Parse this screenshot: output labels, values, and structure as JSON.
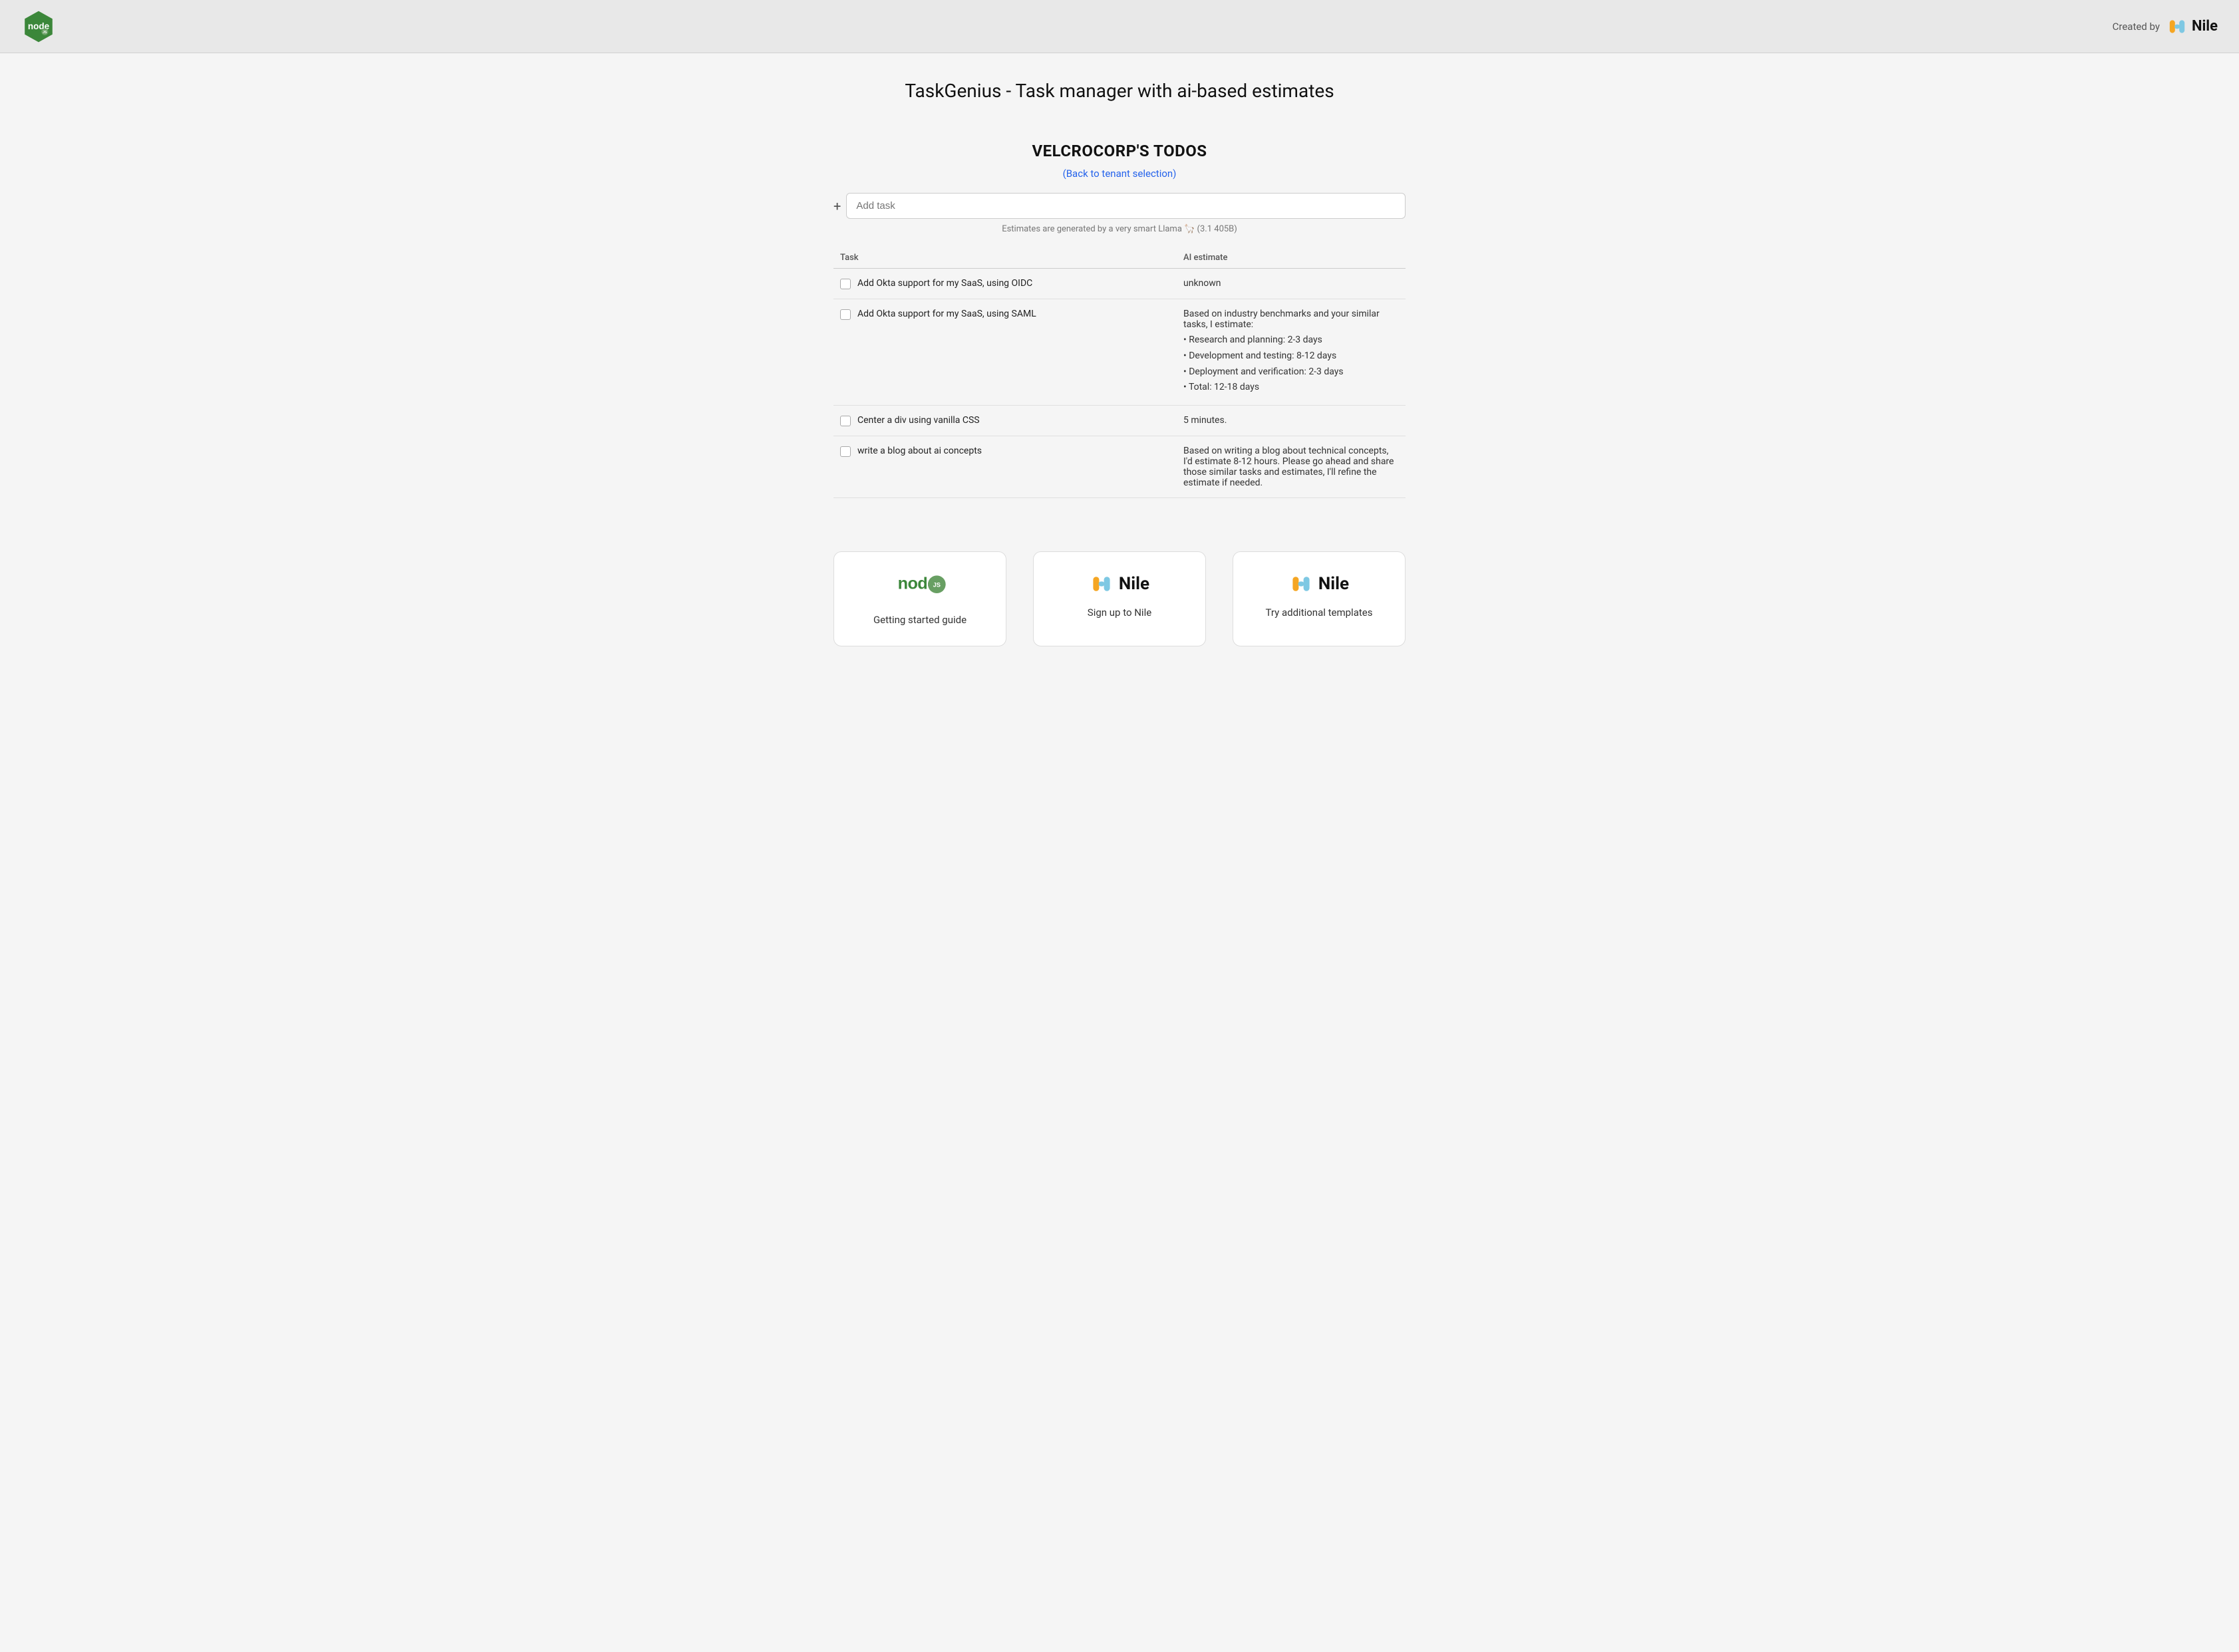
{
  "header": {
    "created_by_label": "Created by",
    "nile_wordmark": "Nile"
  },
  "page": {
    "title": "TaskGenius - Task manager with ai-based estimates",
    "tenant_title": "VELCROCORP'S TODOS",
    "back_link_label": "(Back to tenant selection)",
    "add_task_placeholder": "Add task",
    "ai_note": "Estimates are generated by a very smart Llama 🦙 (3.1 405B)",
    "table_headers": {
      "task": "Task",
      "ai_estimate": "AI estimate"
    },
    "tasks": [
      {
        "id": 1,
        "text": "Add Okta support for my SaaS, using OIDC",
        "estimate": "unknown",
        "estimate_type": "simple"
      },
      {
        "id": 2,
        "text": "Add Okta support for my SaaS, using SAML",
        "estimate_intro": "Based on industry benchmarks and your similar tasks, I estimate:",
        "estimate_items": [
          "Research and planning: 2-3 days",
          "Development and testing: 8-12 days",
          "Deployment and verification: 2-3 days",
          "Total: 12-18 days"
        ],
        "estimate_type": "list"
      },
      {
        "id": 3,
        "text": "Center a div using vanilla CSS",
        "estimate": "5 minutes.",
        "estimate_type": "simple"
      },
      {
        "id": 4,
        "text": "write a blog about ai concepts",
        "estimate": "Based on writing a blog about technical concepts, I'd estimate 8-12 hours. Please go ahead and share those similar tasks and estimates, I'll refine the estimate if needed.",
        "estimate_type": "simple"
      }
    ]
  },
  "bottom_cards": [
    {
      "id": "nodejs",
      "label": "Getting started guide",
      "type": "nodejs"
    },
    {
      "id": "nile-signup",
      "label": "Sign up to Nile",
      "type": "nile"
    },
    {
      "id": "nile-templates",
      "label": "Try additional templates",
      "type": "nile"
    }
  ]
}
